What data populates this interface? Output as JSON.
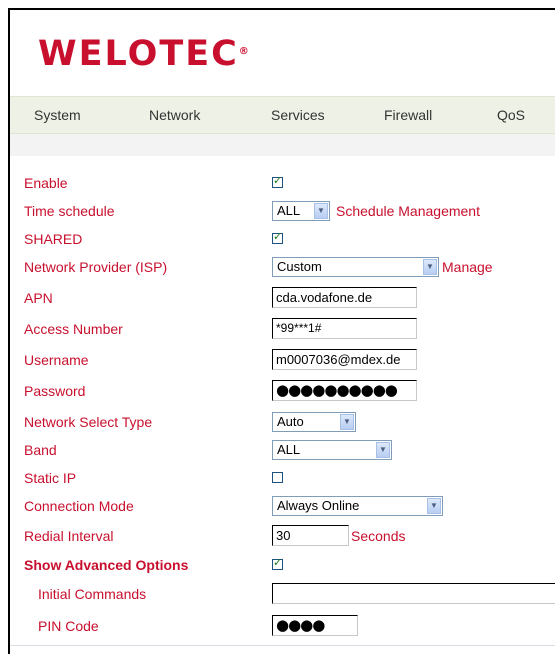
{
  "brand": {
    "logo_text": "WELOTEC",
    "logo_mark": "®"
  },
  "nav": {
    "items": [
      "System",
      "Network",
      "Services",
      "Firewall",
      "QoS"
    ]
  },
  "colors": {
    "label": "#c8102e",
    "nav_bg": "#eef2e6"
  },
  "form": {
    "enable": {
      "label": "Enable",
      "checked": true
    },
    "time_schedule": {
      "label": "Time schedule",
      "value": "ALL",
      "link": "Schedule Management"
    },
    "shared": {
      "label": "SHARED",
      "checked": true
    },
    "isp": {
      "label": "Network Provider (ISP)",
      "value": "Custom",
      "link": "Manage"
    },
    "apn": {
      "label": "APN",
      "value": "cda.vodafone.de"
    },
    "access_number": {
      "label": "Access Number",
      "value": "*99***1#"
    },
    "username": {
      "label": "Username",
      "value": "m0007036@mdex.de"
    },
    "password": {
      "label": "Password",
      "value": "●●●●●●●●●●"
    },
    "network_select_type": {
      "label": "Network Select Type",
      "value": "Auto"
    },
    "band": {
      "label": "Band",
      "value": "ALL"
    },
    "static_ip": {
      "label": "Static IP",
      "checked": false
    },
    "connection_mode": {
      "label": "Connection Mode",
      "value": "Always Online"
    },
    "redial_interval": {
      "label": "Redial Interval",
      "value": "30",
      "unit": "Seconds"
    },
    "show_advanced": {
      "label": "Show Advanced Options",
      "checked": true
    },
    "initial_commands": {
      "label": "Initial Commands",
      "value": ""
    },
    "pin_code": {
      "label": "PIN Code",
      "value": "●●●●"
    }
  }
}
